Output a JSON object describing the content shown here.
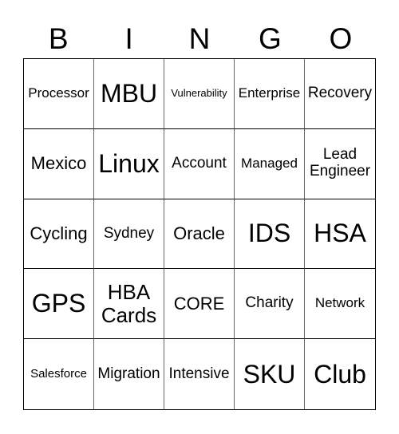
{
  "header": [
    "B",
    "I",
    "N",
    "G",
    "O"
  ],
  "cells": [
    {
      "text": "Processor",
      "size": "m"
    },
    {
      "text": "MBU",
      "size": "xl"
    },
    {
      "text": "Vulnerability",
      "size": "xs"
    },
    {
      "text": "Enterprise",
      "size": "m"
    },
    {
      "text": "Recovery",
      "size": "ml"
    },
    {
      "text": "Mexico",
      "size": "l"
    },
    {
      "text": "Linux",
      "size": "xl"
    },
    {
      "text": "Account",
      "size": "ml"
    },
    {
      "text": "Managed",
      "size": "m"
    },
    {
      "text": "Lead\nEngineer",
      "size": "ml"
    },
    {
      "text": "Cycling",
      "size": "l"
    },
    {
      "text": "Sydney",
      "size": "ml"
    },
    {
      "text": "Oracle",
      "size": "l"
    },
    {
      "text": "IDS",
      "size": "xl"
    },
    {
      "text": "HSA",
      "size": "xl"
    },
    {
      "text": "GPS",
      "size": "xl"
    },
    {
      "text": "HBA\nCards",
      "size": "lg2"
    },
    {
      "text": "CORE",
      "size": "l"
    },
    {
      "text": "Charity",
      "size": "ml"
    },
    {
      "text": "Network",
      "size": "m"
    },
    {
      "text": "Salesforce",
      "size": "s"
    },
    {
      "text": "Migration",
      "size": "ml"
    },
    {
      "text": "Intensive",
      "size": "ml"
    },
    {
      "text": "SKU",
      "size": "xl"
    },
    {
      "text": "Club",
      "size": "xl"
    }
  ]
}
